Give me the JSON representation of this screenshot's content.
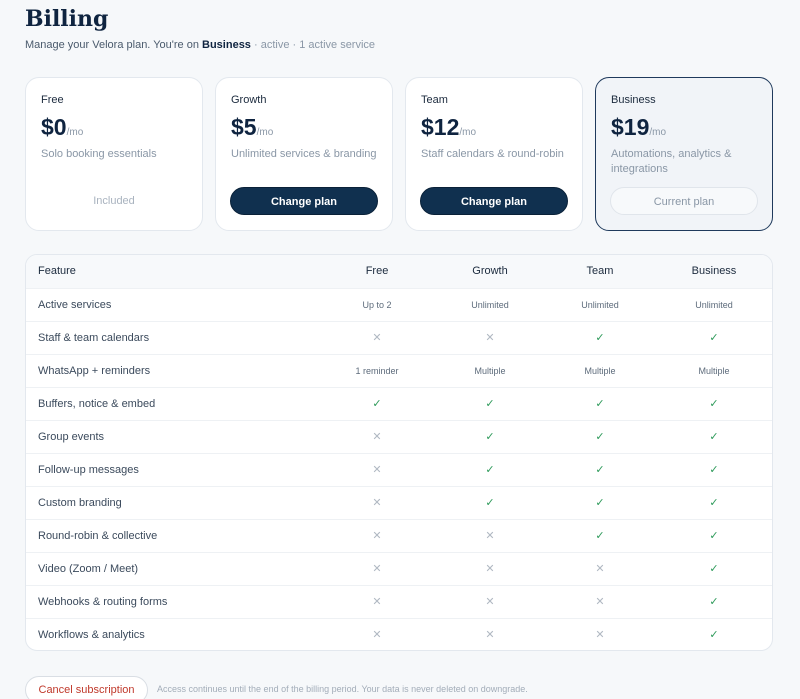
{
  "page": {
    "title": "Billing",
    "subtitle_prefix": "Manage your Velora plan. You're on ",
    "current_plan": "Business",
    "subtitle_meta": " · active · 1 active service"
  },
  "plans": [
    {
      "name": "Free",
      "price": "$0",
      "period": "/mo",
      "desc": "Solo booking essentials",
      "action": "Included"
    },
    {
      "name": "Growth",
      "price": "$5",
      "period": "/mo",
      "desc": "Unlimited services & branding",
      "action": "Change plan"
    },
    {
      "name": "Team",
      "price": "$12",
      "period": "/mo",
      "desc": "Staff calendars & round-robin",
      "action": "Change plan"
    },
    {
      "name": "Business",
      "price": "$19",
      "period": "/mo",
      "desc": "Automations, analytics & integrations",
      "action": "Current plan"
    }
  ],
  "table": {
    "headers": [
      "Feature",
      "Free",
      "Growth",
      "Team",
      "Business"
    ],
    "rows": [
      {
        "feature": "Active services",
        "values": [
          "Up to 2",
          "Unlimited",
          "Unlimited",
          "Unlimited"
        ]
      },
      {
        "feature": "Staff & team calendars",
        "values": [
          "✕",
          "✕",
          "✓",
          "✓"
        ]
      },
      {
        "feature": "WhatsApp + reminders",
        "values": [
          "1 reminder",
          "Multiple",
          "Multiple",
          "Multiple"
        ]
      },
      {
        "feature": "Buffers, notice & embed",
        "values": [
          "✓",
          "✓",
          "✓",
          "✓"
        ]
      },
      {
        "feature": "Group events",
        "values": [
          "✕",
          "✓",
          "✓",
          "✓"
        ]
      },
      {
        "feature": "Follow-up messages",
        "values": [
          "✕",
          "✓",
          "✓",
          "✓"
        ]
      },
      {
        "feature": "Custom branding",
        "values": [
          "✕",
          "✓",
          "✓",
          "✓"
        ]
      },
      {
        "feature": "Round-robin & collective",
        "values": [
          "✕",
          "✕",
          "✓",
          "✓"
        ]
      },
      {
        "feature": "Video (Zoom / Meet)",
        "values": [
          "✕",
          "✕",
          "✕",
          "✓"
        ]
      },
      {
        "feature": "Webhooks & routing forms",
        "values": [
          "✕",
          "✕",
          "✕",
          "✓"
        ]
      },
      {
        "feature": "Workflows & analytics",
        "values": [
          "✕",
          "✕",
          "✕",
          "✓"
        ]
      }
    ]
  },
  "footer": {
    "cancel_label": "Cancel subscription",
    "note": "Access continues until the end of the billing period. Your data is never deleted on downgrade."
  },
  "colors": {
    "primary": "#10304f",
    "check": "#2e9a5a",
    "cross": "#b0b8c2",
    "danger": "#c0392b"
  }
}
